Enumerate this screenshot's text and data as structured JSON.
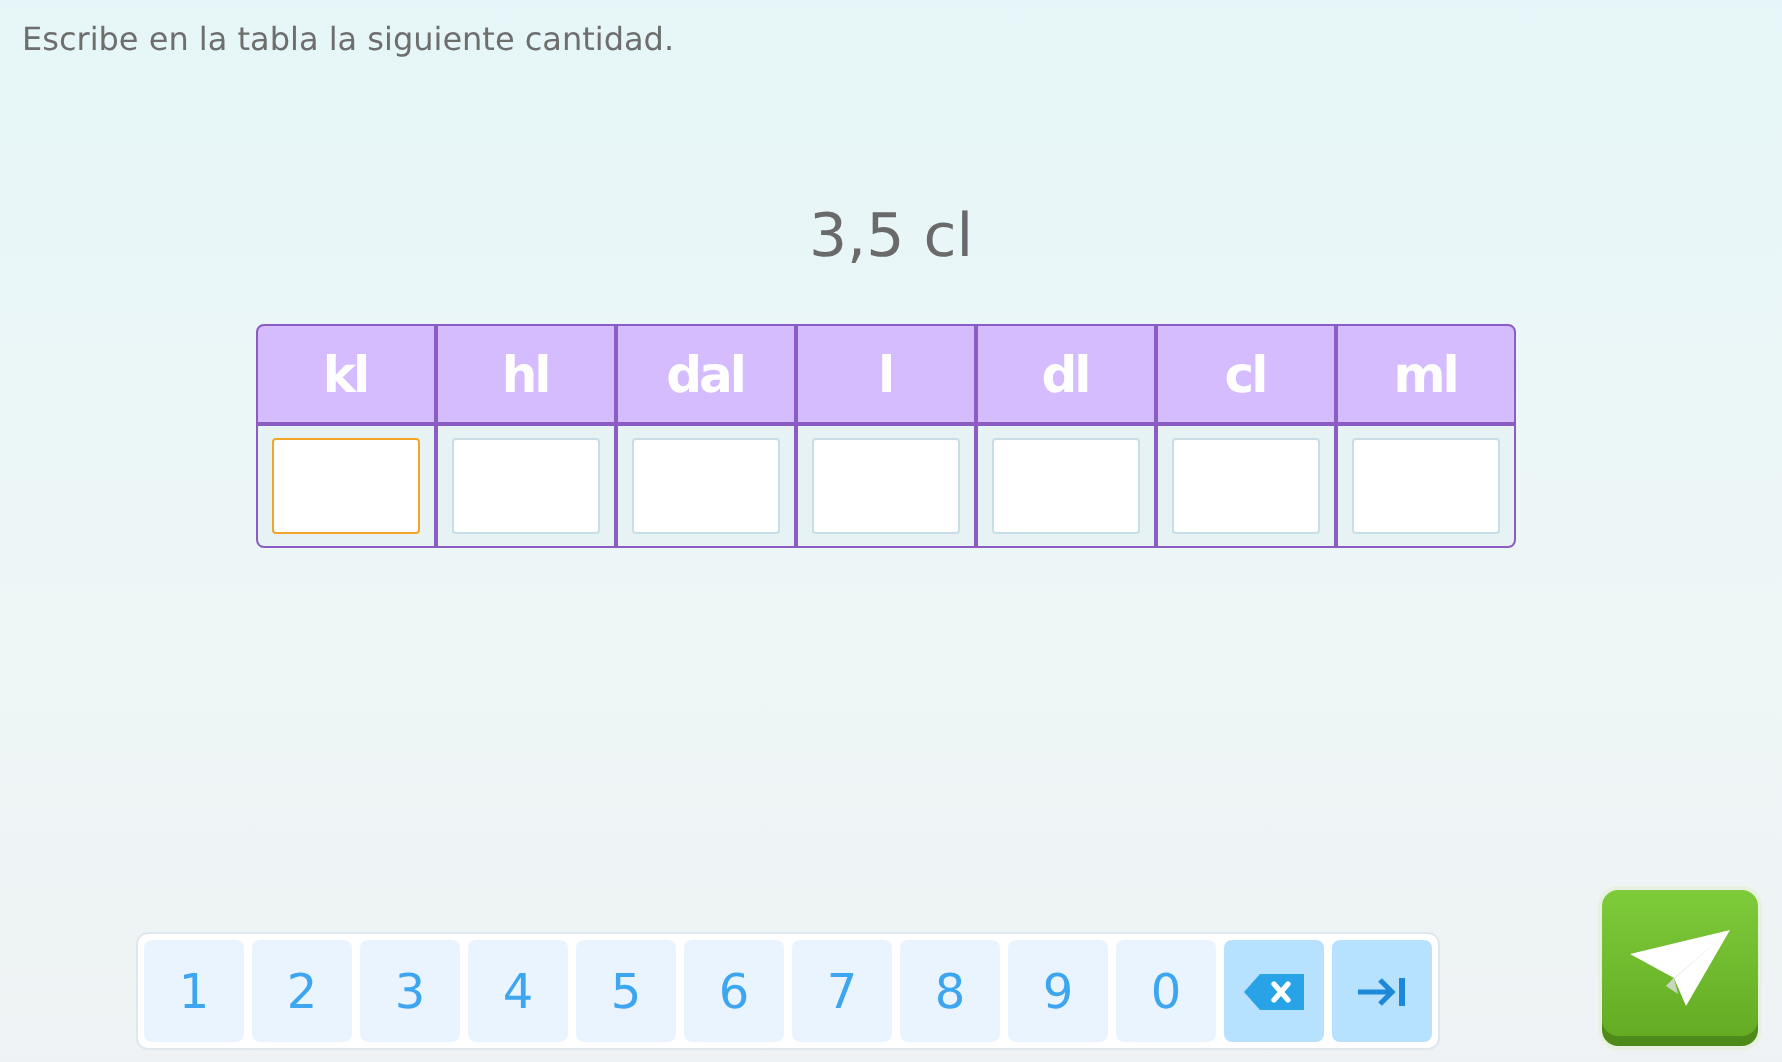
{
  "instruction": "Escribe en la tabla la siguiente cantidad.",
  "quantity": "3,5 cl",
  "table": {
    "columns": [
      "kl",
      "hl",
      "dal",
      "l",
      "dl",
      "cl",
      "ml"
    ],
    "inputs": [
      {
        "focused": true
      },
      {
        "focused": false
      },
      {
        "focused": false
      },
      {
        "focused": false
      },
      {
        "focused": false
      },
      {
        "focused": false
      },
      {
        "focused": false
      }
    ]
  },
  "keypad": [
    {
      "kind": "digit",
      "label": "1"
    },
    {
      "kind": "digit",
      "label": "2"
    },
    {
      "kind": "digit",
      "label": "3"
    },
    {
      "kind": "digit",
      "label": "4"
    },
    {
      "kind": "digit",
      "label": "5"
    },
    {
      "kind": "digit",
      "label": "6"
    },
    {
      "kind": "digit",
      "label": "7"
    },
    {
      "kind": "digit",
      "label": "8"
    },
    {
      "kind": "digit",
      "label": "9"
    },
    {
      "kind": "digit",
      "label": "0"
    },
    {
      "kind": "backspace"
    },
    {
      "kind": "next"
    }
  ]
}
